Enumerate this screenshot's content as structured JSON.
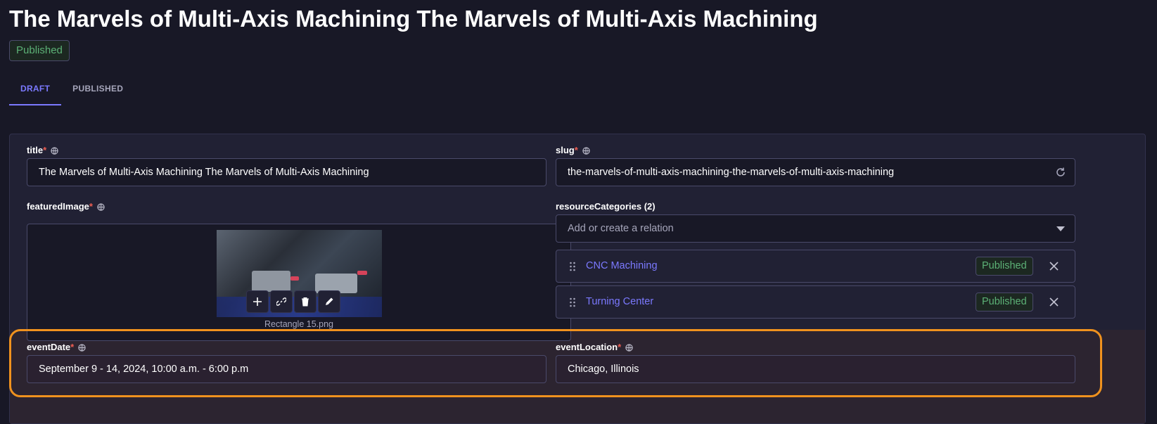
{
  "header": {
    "title": "The Marvels of Multi-Axis Machining The Marvels of Multi-Axis Machining",
    "status": "Published"
  },
  "tabs": [
    {
      "label": "DRAFT",
      "active": true
    },
    {
      "label": "PUBLISHED",
      "active": false
    }
  ],
  "fields": {
    "title": {
      "label": "title",
      "value": "The Marvels of Multi-Axis Machining The Marvels of Multi-Axis Machining"
    },
    "slug": {
      "label": "slug",
      "value": "the-marvels-of-multi-axis-machining-the-marvels-of-multi-axis-machining"
    },
    "featured_image": {
      "label": "featuredImage",
      "file_name": "Rectangle 15.png"
    },
    "resource_categories": {
      "label": "resourceCategories (2)",
      "placeholder": "Add or create a relation",
      "items": [
        {
          "name": "CNC Machining",
          "status": "Published"
        },
        {
          "name": "Turning Center",
          "status": "Published"
        }
      ]
    },
    "event_date": {
      "label": "eventDate",
      "value": "September 9 - 14, 2024, 10:00 a.m. - 6:00 p.m"
    },
    "event_location": {
      "label": "eventLocation",
      "value": "Chicago, Illinois"
    }
  },
  "colors": {
    "accent": "#7b79ff",
    "published": "#5cb176",
    "required": "#ee5e52",
    "highlight": "#f0921e",
    "background": "#181826",
    "panel": "#212134"
  }
}
